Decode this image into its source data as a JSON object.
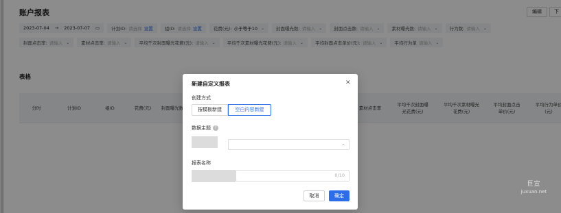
{
  "header": {
    "title": "账户报表",
    "edit_label": "编辑",
    "more_label": "下"
  },
  "filters_row1": {
    "date_start": "2023-07-04",
    "date_sep": "→",
    "date_end": "2023-07-07",
    "plan_label": "计划ID:",
    "plan_placeholder": "请选择",
    "plan_link": "设置",
    "group_label": "组ID:",
    "group_placeholder": "请选择",
    "group_link": "设置",
    "cost_label": "花费(元):",
    "cost_value": "小于等于10",
    "cover_exp_label": "封面曝光数:",
    "cover_exp_placeholder": "请输入",
    "cover_click_label": "封面点击数:",
    "cover_click_placeholder": "请输入",
    "mat_exp_label": "素材曝光数:",
    "mat_exp_placeholder": "请输入",
    "action_label": "行为数:",
    "action_placeholder": "请输入"
  },
  "filters_row2": {
    "cover_ctr_label": "封面点击率:",
    "cover_ctr_placeholder": "请输入",
    "mat_ctr_label": "素材点击率:",
    "mat_ctr_placeholder": "请输入",
    "cover_cpm_label": "平均千次封面曝光花费(元):",
    "cover_cpm_placeholder": "请输入",
    "mat_cpm_label": "平均千次素材曝光花费(元):",
    "mat_cpm_placeholder": "请输入",
    "cover_cpc_label": "平均封面点击单价(元):",
    "cover_cpc_placeholder": "请输入",
    "action_price_label": "平均行为单",
    "action_price_placeholder": "请输入"
  },
  "table": {
    "section_title": "表格",
    "headers": [
      "分时",
      "计划ID",
      "组ID",
      "花费(元)",
      "封面曝光数",
      "素材点击率",
      "平均千次封面曝光花费(元)",
      "平均千次素材曝光花费(元)",
      "平均封面点击单价(元)",
      "平均行为单价(元)"
    ]
  },
  "modal": {
    "title": "新建自定义报表",
    "method_label": "创建方式",
    "option_template": "按模板新建",
    "option_blank": "空白内容新建",
    "subject_label": "数据主题",
    "name_label": "报表名称",
    "name_counter": "0/10",
    "cancel_label": "取消",
    "confirm_label": "确定"
  },
  "watermark": {
    "line1": "巨宣",
    "line2": "juxuan.net"
  },
  "colors": {
    "accent": "#2d6de8",
    "overlay": "rgba(0,0,0,0.45)"
  }
}
